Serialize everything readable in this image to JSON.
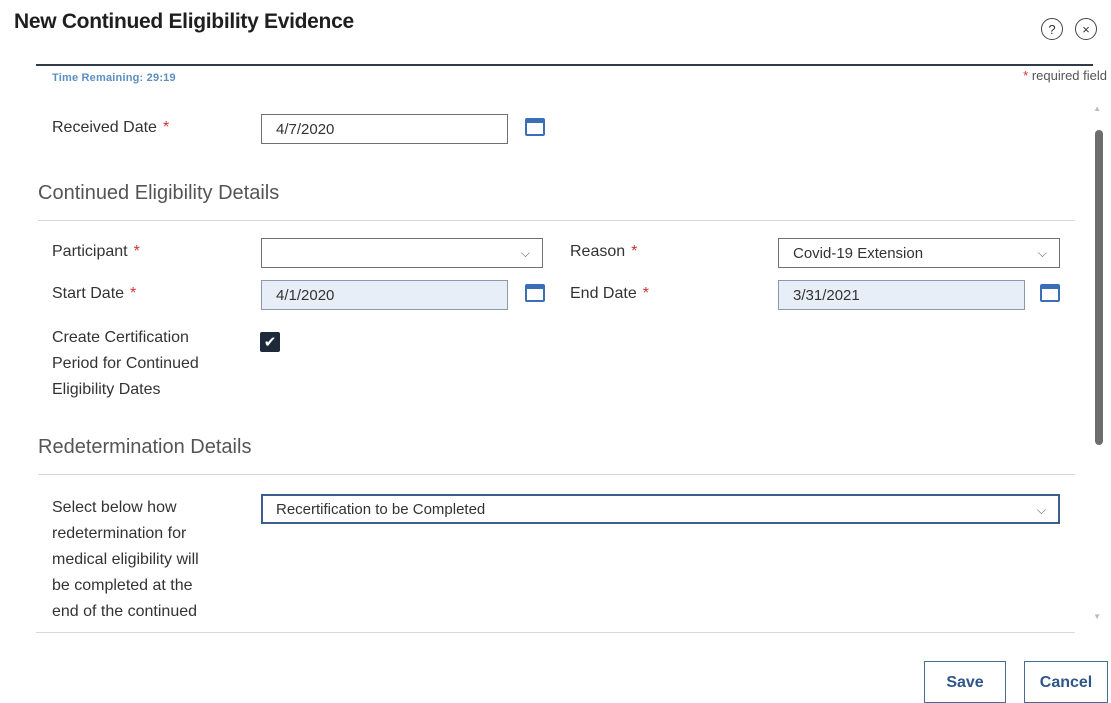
{
  "dialog": {
    "title": "New Continued Eligibility Evidence",
    "help_icon": "?",
    "close_icon": "×"
  },
  "timer": "Time Remaining: 29:19",
  "required_note": {
    "star": "*",
    "text": " required field"
  },
  "received_date": {
    "label": "Received Date",
    "value": "4/7/2020"
  },
  "required_star": "*",
  "sections": {
    "continued": "Continued Eligibility Details",
    "redetermination": "Redetermination Details"
  },
  "participant": {
    "label": "Participant",
    "value": ""
  },
  "reason": {
    "label": "Reason",
    "value": "Covid-19 Extension"
  },
  "start_date": {
    "label": "Start Date",
    "value": "4/1/2020"
  },
  "end_date": {
    "label": "End Date",
    "value": "3/31/2021"
  },
  "certification": {
    "label_lines": [
      "Create Certification",
      "Period for Continued",
      "Eligibility Dates"
    ],
    "checked": true,
    "check_mark": "✔"
  },
  "redetermination": {
    "label_lines": [
      "Select below how",
      "redetermination for",
      "medical eligibility will",
      "be completed at the",
      "end of the continued"
    ],
    "value": "Recertification to be Completed"
  },
  "chevron": "⌵",
  "buttons": {
    "save": "Save",
    "cancel": "Cancel"
  },
  "colors": {
    "accent": "#3a6fb7",
    "required": "#cc3333",
    "readonly_bg": "#e8eef8",
    "timer": "#5b8fc2"
  }
}
